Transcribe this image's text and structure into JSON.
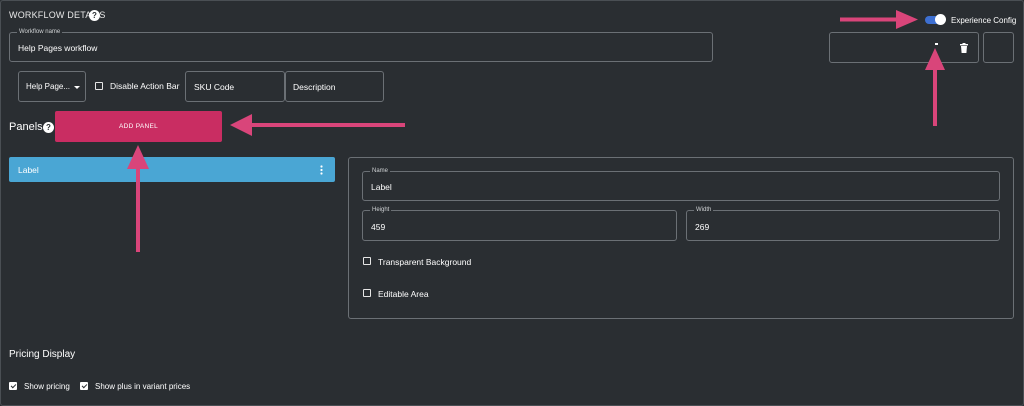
{
  "header": {
    "title": "WORKFLOW DETAILS",
    "help_glyph": "?",
    "toggle_label": "Experience Config",
    "toggle_on": true
  },
  "workflow_name": {
    "label": "Workflow name",
    "value": "Help Pages workflow"
  },
  "toolbar": {
    "dropdown_value": "Help Page...",
    "disable_action_bar_label": "Disable Action Bar",
    "disable_action_bar_checked": false,
    "sku_placeholder": "SKU Code",
    "description_placeholder": "Description"
  },
  "panels": {
    "title": "Panels",
    "help_glyph": "?",
    "add_button_label": "ADD PANEL",
    "items": [
      {
        "label": "Label"
      }
    ]
  },
  "panel_editor": {
    "name_label": "Name",
    "name_value": "Label",
    "height_label": "Height",
    "height_value": "459",
    "width_label": "Width",
    "width_value": "269",
    "transparent_label": "Transparent Background",
    "transparent_checked": false,
    "editable_label": "Editable Area",
    "editable_checked": false
  },
  "pricing": {
    "title": "Pricing Display",
    "show_pricing_label": "Show pricing",
    "show_pricing_checked": true,
    "show_plus_label": "Show plus in variant prices",
    "show_plus_checked": true
  },
  "colors": {
    "background": "#2b2f33",
    "accent_pink": "#c92d62",
    "panel_blue": "#4aa6d4",
    "toggle_blue": "#3d6fd1",
    "arrow_pink": "#d9457a"
  },
  "icons": {
    "trash": "trash-icon",
    "kebab": "more-vert-icon",
    "dropdown": "caret-down-icon"
  }
}
